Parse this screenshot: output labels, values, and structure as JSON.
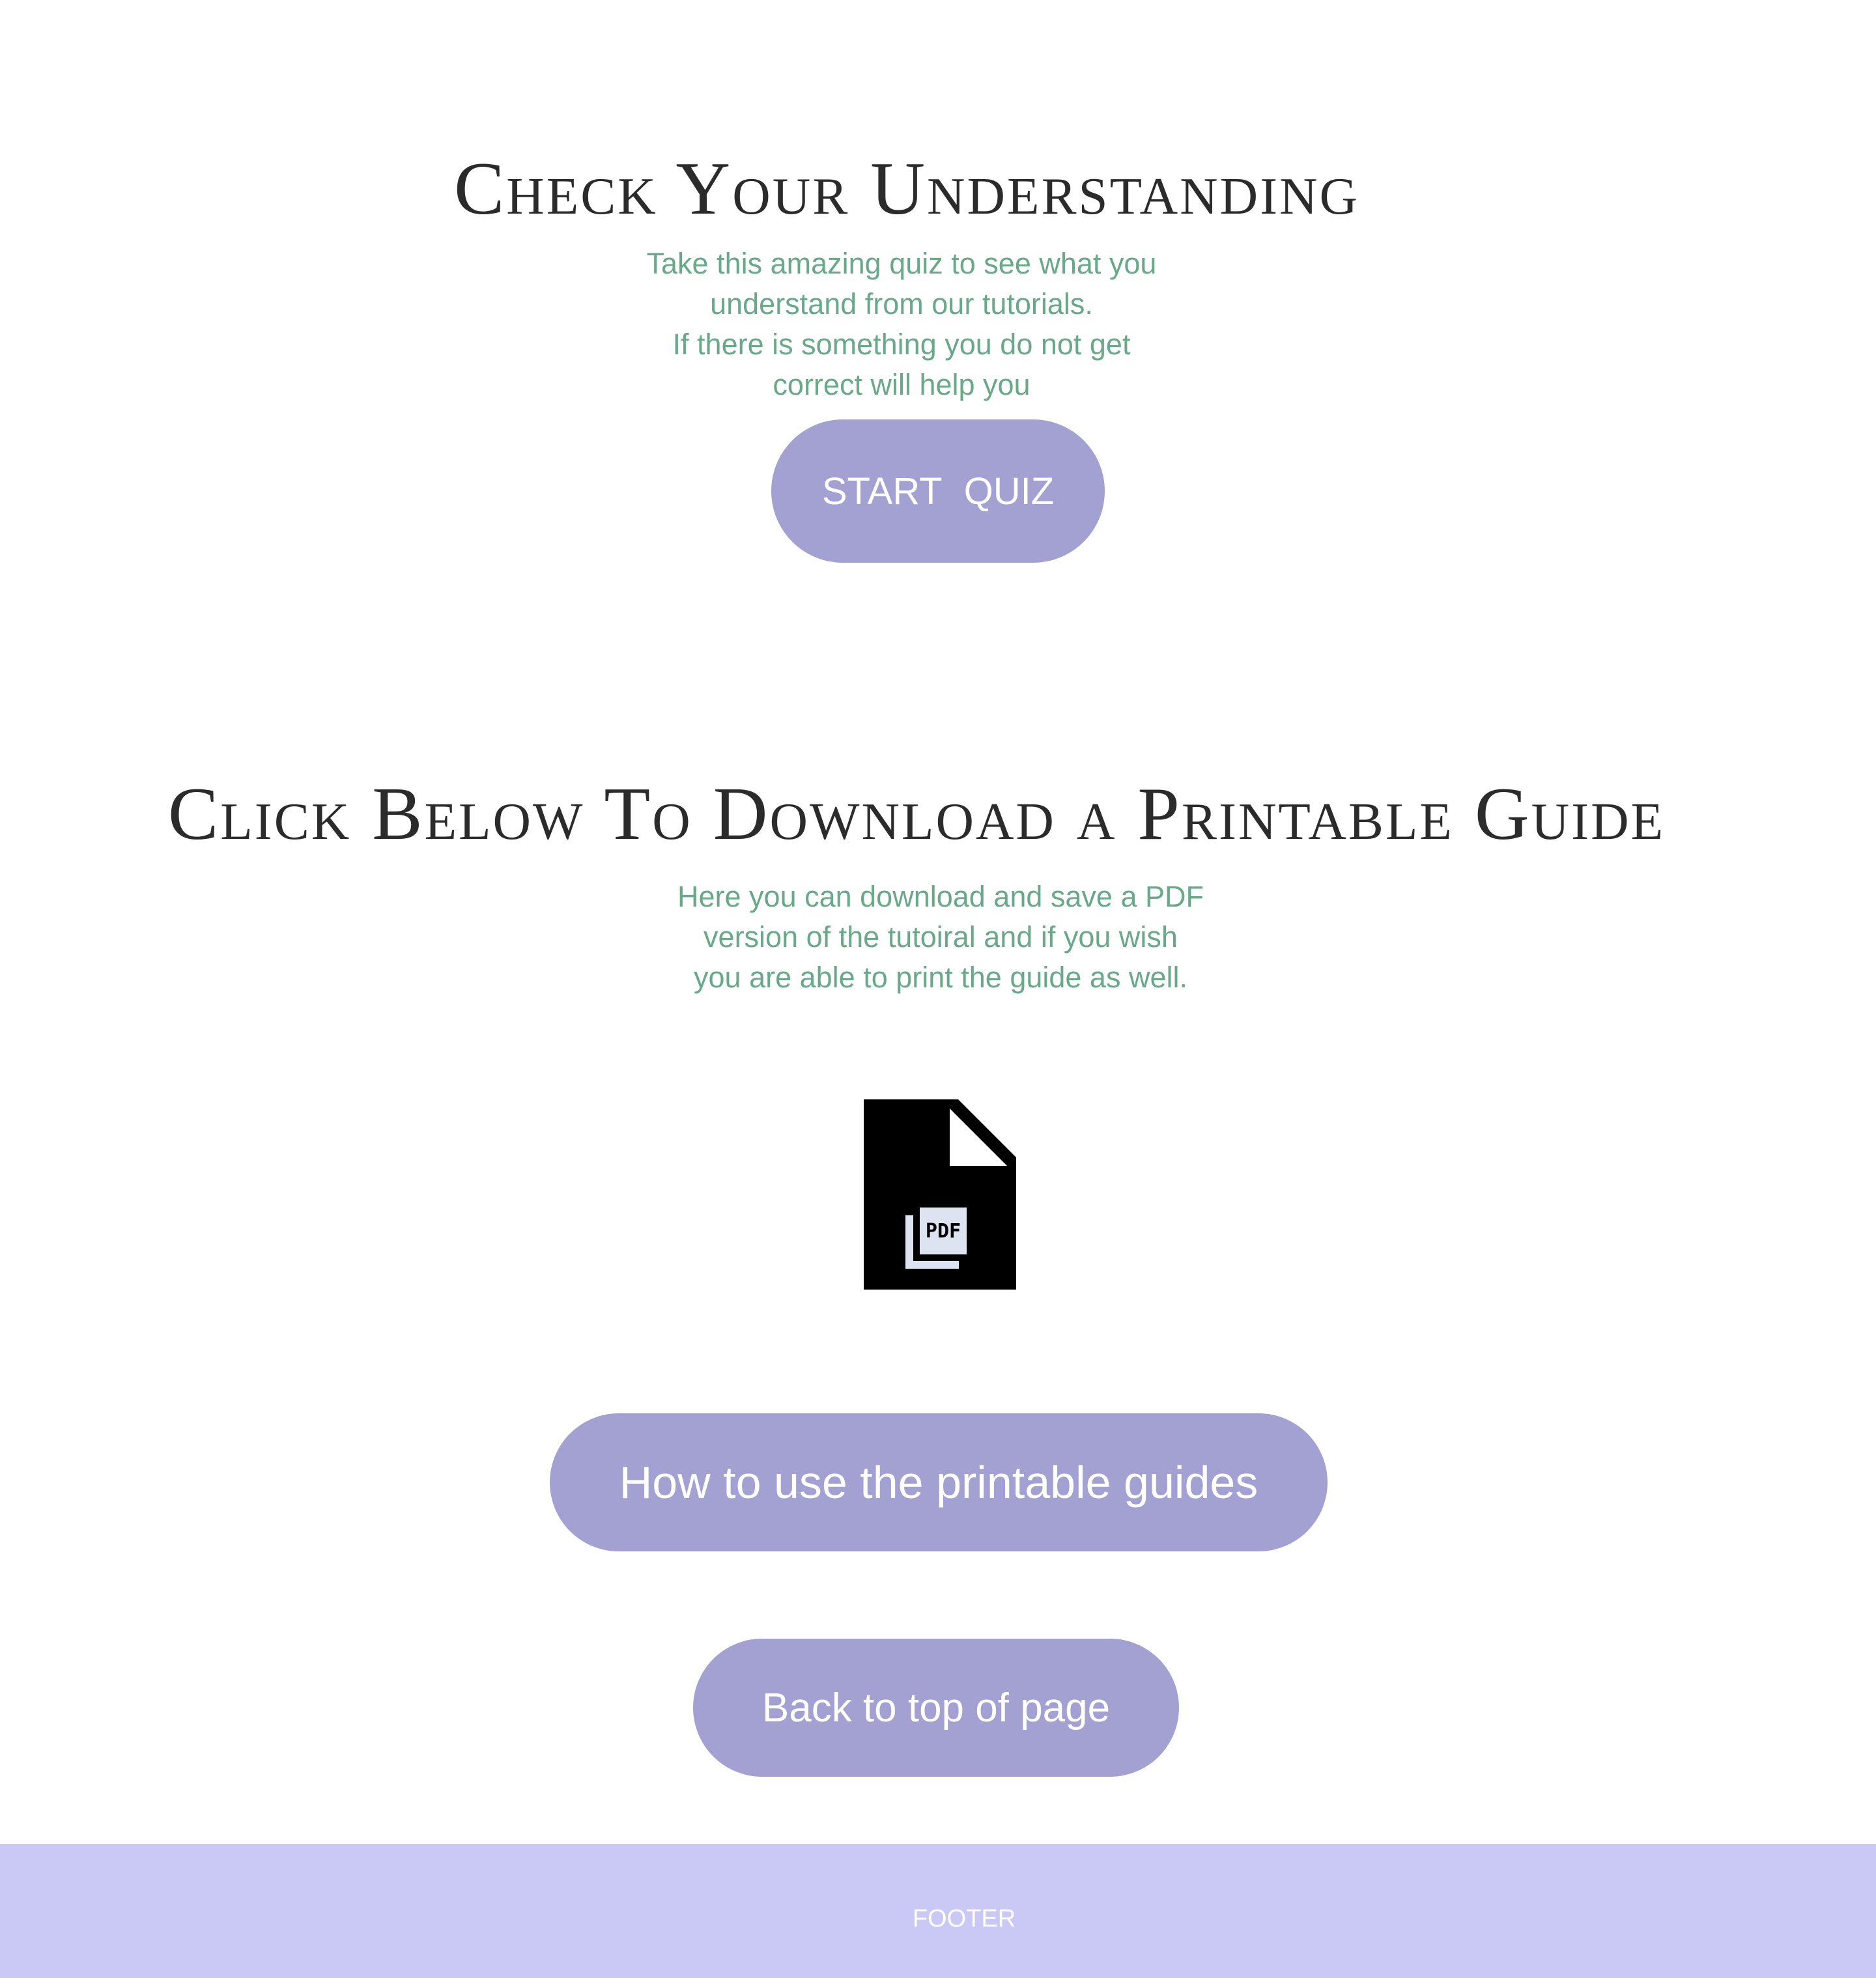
{
  "quiz_section": {
    "title": "Check Your Understanding",
    "description_lines": [
      "Take this amazing quiz to see what you",
      "understand from our tutorials.",
      "If there is something you do not get",
      "correct will help you"
    ],
    "button_label": "START  QUIZ"
  },
  "guide_section": {
    "title": "Click Below To Download a Printable Guide",
    "description_lines": [
      "Here you can download and save a PDF",
      "version of the tutoiral and if you wish",
      "you are able to print the guide as well."
    ],
    "pdf_icon": "pdf-file-icon",
    "pdf_icon_text": "PDF",
    "howto_button_label": "How to use the printable guides",
    "back_to_top_label": "Back to top of page"
  },
  "footer": {
    "text": "FOOTER"
  },
  "colors": {
    "heading": "#2b2b2b",
    "description": "#6aa88a",
    "button_bg": "#a3a0d2",
    "button_text": "#ffffff",
    "footer_bg": "#cac8f4"
  }
}
